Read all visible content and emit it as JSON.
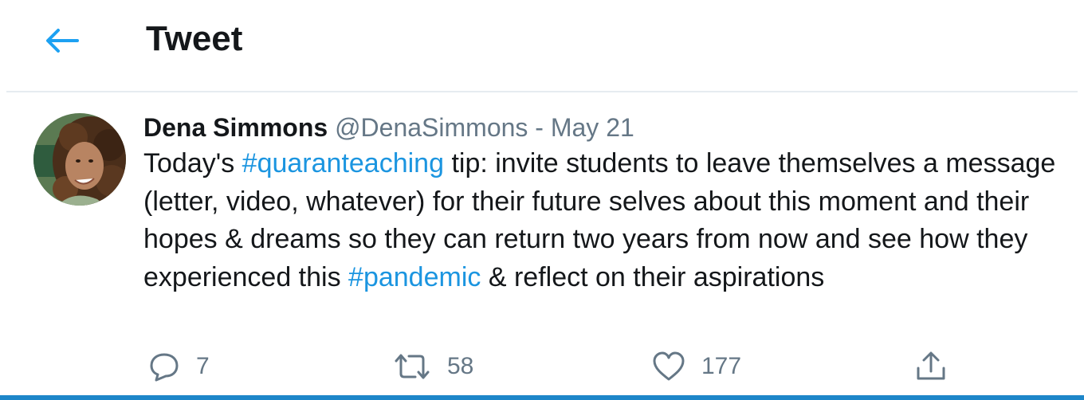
{
  "header": {
    "title": "Tweet",
    "back_icon": "arrow-left-icon",
    "accent_color": "#1da1f2"
  },
  "tweet": {
    "author_name": "Dena Simmons",
    "author_handle": "@DenaSimmons",
    "separator": "-",
    "date": "May 21",
    "text_parts": {
      "p1": "Today's ",
      "tag1": "#quaranteaching",
      "p2": " tip: invite students to leave themselves a message (letter, video, whatever) for their future selves about this moment and their hopes & dreams so they can return two years from now and see how they experienced this ",
      "tag2": "#pandemic",
      "p3": " & reflect on their aspirations"
    },
    "hashtag_color": "#1b95e0"
  },
  "actions": {
    "reply": {
      "icon": "reply-icon",
      "count": "7"
    },
    "retweet": {
      "icon": "retweet-icon",
      "count": "58"
    },
    "like": {
      "icon": "heart-icon",
      "count": "177"
    },
    "share": {
      "icon": "share-icon"
    }
  }
}
